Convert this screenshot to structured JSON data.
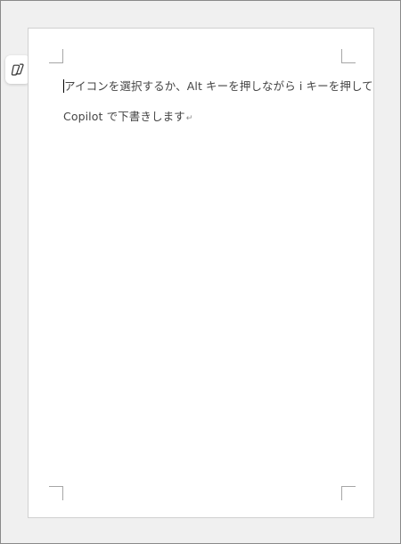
{
  "placeholder": {
    "line1": "アイコンを選択するか、Alt  キーを押しながら  i  キーを押して",
    "line2": "Copilot  で下書きします"
  },
  "paragraph_mark": "↵",
  "icons": {
    "copilot": "copilot-icon"
  }
}
